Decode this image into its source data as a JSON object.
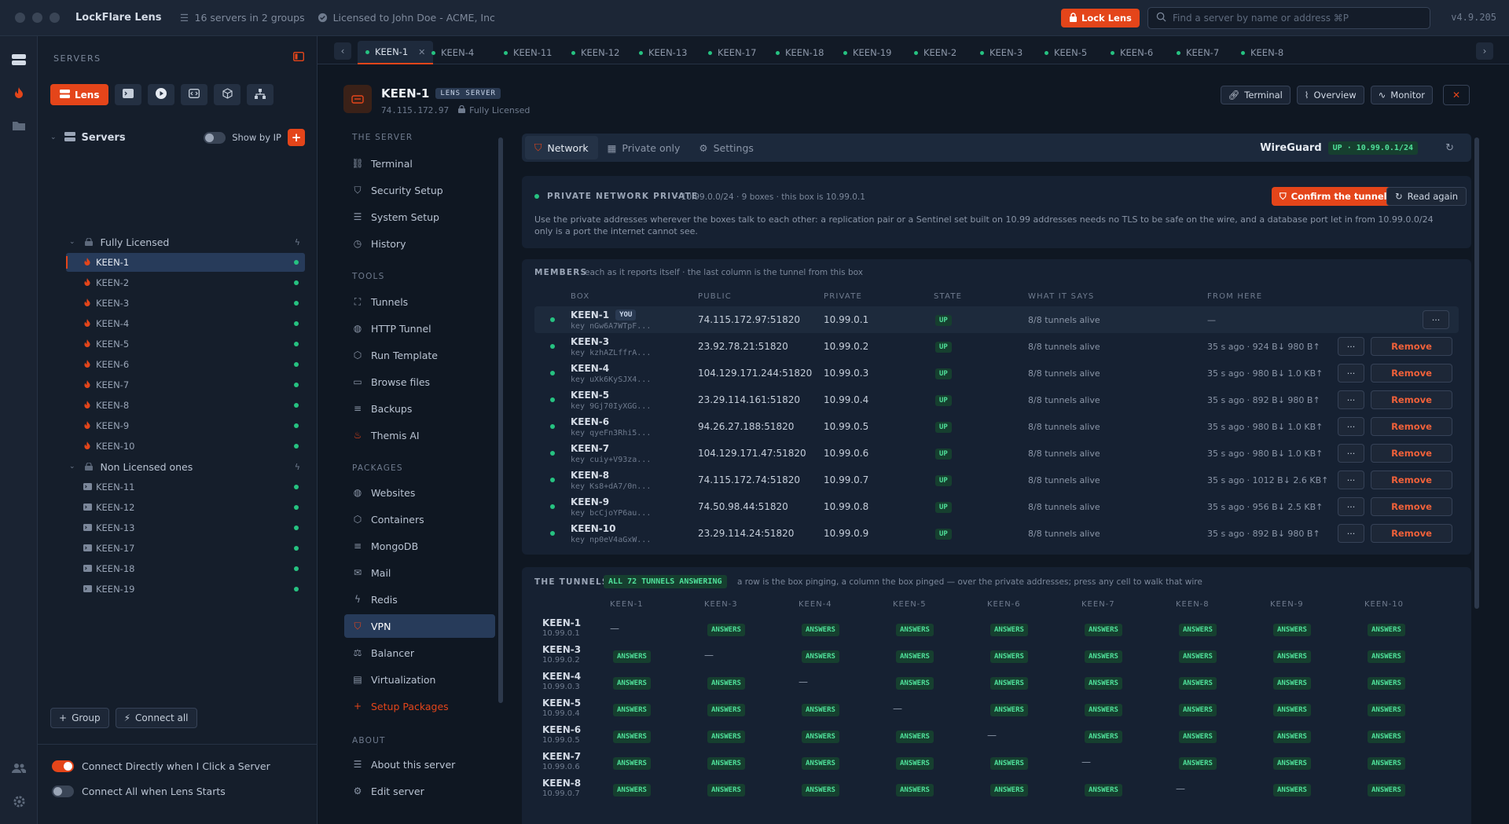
{
  "titlebar": {
    "app": "LockFlare Lens",
    "servers_summary": "16 servers in 2 groups",
    "license": "Licensed to John Doe - ACME, Inc",
    "lock_button": "Lock Lens",
    "search_placeholder": "Find a server by name or address ⌘P",
    "version": "v4.9.205"
  },
  "sidebar": {
    "title": "SERVERS",
    "tabs": {
      "lens": "Lens"
    },
    "tree_title": "Servers",
    "show_by_ip": "Show by IP",
    "groups": [
      {
        "name": "Fully Licensed",
        "servers": [
          "KEEN-1",
          "KEEN-2",
          "KEEN-3",
          "KEEN-4",
          "KEEN-5",
          "KEEN-6",
          "KEEN-7",
          "KEEN-8",
          "KEEN-9",
          "KEEN-10"
        ]
      },
      {
        "name": "Non Licensed ones",
        "servers": [
          "KEEN-11",
          "KEEN-12",
          "KEEN-13",
          "KEEN-17",
          "KEEN-18",
          "KEEN-19"
        ]
      }
    ],
    "group_button": "Group",
    "connect_all_button": "Connect all",
    "opt_connect_directly": "Connect Directly when I Click a Server",
    "opt_connect_all": "Connect All when Lens Starts"
  },
  "tabs": [
    "KEEN-1",
    "KEEN-4",
    "KEEN-11",
    "KEEN-12",
    "KEEN-13",
    "KEEN-17",
    "KEEN-18",
    "KEEN-19",
    "KEEN-2",
    "KEEN-3",
    "KEEN-5",
    "KEEN-6",
    "KEEN-7",
    "KEEN-8"
  ],
  "server": {
    "name": "KEEN-1",
    "badge": "LENS SERVER",
    "ip": "74.115.172.97",
    "license": "Fully Licensed",
    "btn_terminal": "Terminal",
    "btn_overview": "Overview",
    "btn_monitor": "Monitor"
  },
  "menu": {
    "sec_server": "THE SERVER",
    "terminal": "Terminal",
    "security": "Security Setup",
    "system": "System Setup",
    "history": "History",
    "sec_tools": "TOOLS",
    "tunnels": "Tunnels",
    "http_tunnel": "HTTP Tunnel",
    "run_template": "Run Template",
    "browse": "Browse files",
    "backups": "Backups",
    "themis": "Themis AI",
    "sec_packages": "PACKAGES",
    "websites": "Websites",
    "containers": "Containers",
    "mongodb": "MongoDB",
    "mail": "Mail",
    "redis": "Redis",
    "vpn": "VPN",
    "balancer": "Balancer",
    "virtualization": "Virtualization",
    "setup_packages": "Setup Packages",
    "sec_about": "ABOUT",
    "about": "About this server",
    "edit": "Edit server"
  },
  "subtabs": {
    "network": "Network",
    "private": "Private only",
    "settings": "Settings"
  },
  "wireguard": {
    "label": "WireGuard",
    "status": "UP · 10.99.0.1/24"
  },
  "private_net": {
    "title": "PRIVATE NETWORK PRIVATE",
    "meta": "· 10.99.0.0/24 · 9 boxes · this box is 10.99.0.1",
    "confirm": "Confirm the tunnels",
    "read_again": "Read again",
    "desc": "Use the private addresses wherever the boxes talk to each other: a replication pair or a Sentinel set built on 10.99 addresses needs no TLS to be safe on the wire, and a database port let in from 10.99.0.0/24 only is a port the internet cannot see."
  },
  "members": {
    "title": "MEMBERS",
    "subtitle": "each as it reports itself · the last column is the tunnel from this box",
    "headers": {
      "box": "BOX",
      "public": "PUBLIC",
      "private": "PRIVATE",
      "state": "STATE",
      "says": "WHAT IT SAYS",
      "from": "FROM HERE"
    },
    "you": "YOU",
    "more": "···",
    "remove": "Remove",
    "rows": [
      {
        "box": "KEEN-1",
        "key": "key nGw6A7WTpF...",
        "public": "74.115.172.97:51820",
        "private": "10.99.0.1",
        "state": "UP",
        "says": "8/8 tunnels alive",
        "from": "—"
      },
      {
        "box": "KEEN-3",
        "key": "key kzhAZLffrA...",
        "public": "23.92.78.21:51820",
        "private": "10.99.0.2",
        "state": "UP",
        "says": "8/8 tunnels alive",
        "from": "35 s ago · 924 B↓ 980 B↑"
      },
      {
        "box": "KEEN-4",
        "key": "key uXk6KySJX4...",
        "public": "104.129.171.244:51820",
        "private": "10.99.0.3",
        "state": "UP",
        "says": "8/8 tunnels alive",
        "from": "35 s ago · 980 B↓ 1.0 KB↑"
      },
      {
        "box": "KEEN-5",
        "key": "key 9Gj70IyXGG...",
        "public": "23.29.114.161:51820",
        "private": "10.99.0.4",
        "state": "UP",
        "says": "8/8 tunnels alive",
        "from": "35 s ago · 892 B↓ 980 B↑"
      },
      {
        "box": "KEEN-6",
        "key": "key qyeFn3Rhi5...",
        "public": "94.26.27.188:51820",
        "private": "10.99.0.5",
        "state": "UP",
        "says": "8/8 tunnels alive",
        "from": "35 s ago · 980 B↓ 1.0 KB↑"
      },
      {
        "box": "KEEN-7",
        "key": "key cuiy+V93za...",
        "public": "104.129.171.47:51820",
        "private": "10.99.0.6",
        "state": "UP",
        "says": "8/8 tunnels alive",
        "from": "35 s ago · 980 B↓ 1.0 KB↑"
      },
      {
        "box": "KEEN-8",
        "key": "key Ks8+dA7/0n...",
        "public": "74.115.172.74:51820",
        "private": "10.99.0.7",
        "state": "UP",
        "says": "8/8 tunnels alive",
        "from": "35 s ago · 1012 B↓ 2.6 KB↑"
      },
      {
        "box": "KEEN-9",
        "key": "key bcCjoYP6au...",
        "public": "74.50.98.44:51820",
        "private": "10.99.0.8",
        "state": "UP",
        "says": "8/8 tunnels alive",
        "from": "35 s ago · 956 B↓ 2.5 KB↑"
      },
      {
        "box": "KEEN-10",
        "key": "key np0eV4aGxW...",
        "public": "23.29.114.24:51820",
        "private": "10.99.0.9",
        "state": "UP",
        "says": "8/8 tunnels alive",
        "from": "35 s ago · 892 B↓ 980 B↑"
      }
    ]
  },
  "tunnels": {
    "title": "THE TUNNELS",
    "badge": "ALL 72 TUNNELS ANSWERING",
    "desc": "a row is the box pinging, a column the box pinged — over the private addresses; press any cell to walk that wire",
    "answers": "ANSWERS",
    "self": "—",
    "columns": [
      "KEEN-1",
      "KEEN-3",
      "KEEN-4",
      "KEEN-5",
      "KEEN-6",
      "KEEN-7",
      "KEEN-8",
      "KEEN-9",
      "KEEN-10"
    ],
    "rows": [
      {
        "name": "KEEN-1",
        "ip": "10.99.0.1"
      },
      {
        "name": "KEEN-3",
        "ip": "10.99.0.2"
      },
      {
        "name": "KEEN-4",
        "ip": "10.99.0.3"
      },
      {
        "name": "KEEN-5",
        "ip": "10.99.0.4"
      },
      {
        "name": "KEEN-6",
        "ip": "10.99.0.5"
      },
      {
        "name": "KEEN-7",
        "ip": "10.99.0.6"
      },
      {
        "name": "KEEN-8",
        "ip": "10.99.0.7"
      }
    ]
  },
  "colors": {
    "accent": "#e4451a",
    "online": "#26c281",
    "answer": "#4fe09a"
  }
}
